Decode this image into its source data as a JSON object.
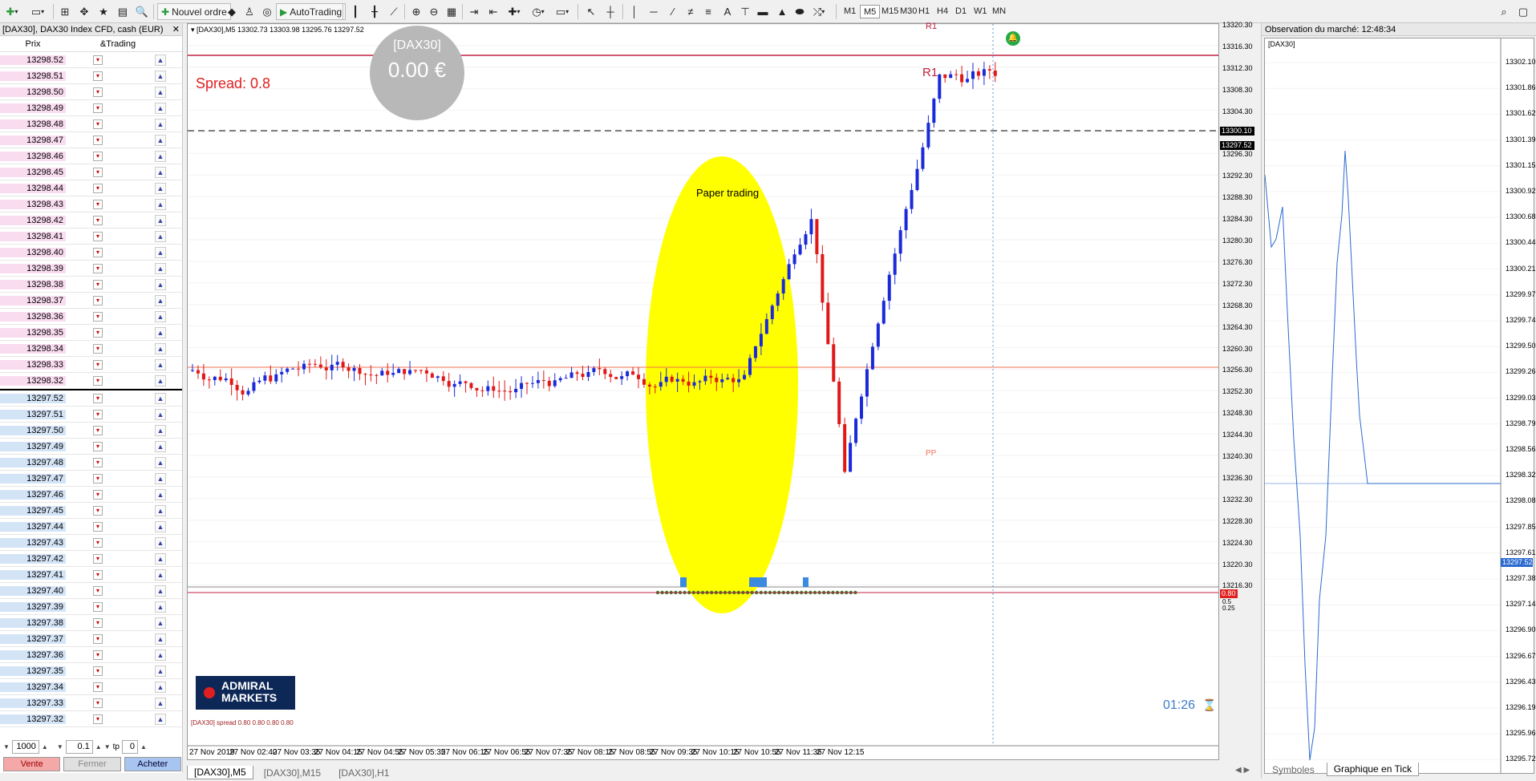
{
  "toolbar": {
    "new_order": "Nouvel ordre",
    "autotrading": "AutoTrading",
    "timeframes": [
      "M1",
      "M5",
      "M15",
      "M30",
      "H1",
      "H4",
      "D1",
      "W1",
      "MN"
    ],
    "active_timeframe": "M5"
  },
  "dom": {
    "title": "[DAX30], DAX30 Index CFD, cash (EUR)",
    "col_price": "Prix",
    "col_trading": "&Trading",
    "asks": [
      "13298.52",
      "13298.51",
      "13298.50",
      "13298.49",
      "13298.48",
      "13298.47",
      "13298.46",
      "13298.45",
      "13298.44",
      "13298.43",
      "13298.42",
      "13298.41",
      "13298.40",
      "13298.39",
      "13298.38",
      "13298.37",
      "13298.36",
      "13298.35",
      "13298.34",
      "13298.33",
      "13298.32"
    ],
    "bids": [
      "13297.52",
      "13297.51",
      "13297.50",
      "13297.49",
      "13297.48",
      "13297.47",
      "13297.46",
      "13297.45",
      "13297.44",
      "13297.43",
      "13297.42",
      "13297.41",
      "13297.40",
      "13297.39",
      "13297.38",
      "13297.37",
      "13297.36",
      "13297.35",
      "13297.34",
      "13297.33",
      "13297.32"
    ],
    "volume": "1000",
    "lot": "0.1",
    "tp_label": "tp",
    "tp_value": "0",
    "sell": "Vente",
    "close": "Fermer",
    "buy": "Acheter"
  },
  "chart": {
    "header": "[DAX30],M5  13302.73 13303.98 13295.76 13297.52",
    "badge_symbol": "[DAX30]",
    "badge_value": "0.00 €",
    "spread": "Spread:  0.8",
    "paper_trading": "Paper trading",
    "r1": "R1",
    "pp": "PP",
    "countdown": "01:26",
    "sub_header": "[DAX30] spread 0.80 0.80 0.80 0.80",
    "brand_line1": "ADMIRAL",
    "brand_line2": "MARKETS",
    "current_price": "13297.52",
    "line_price": "13300.10",
    "spread_value": "0.80",
    "sub_axis": [
      "0.5",
      "0.25"
    ],
    "price_labels": [
      "13320.30",
      "13316.30",
      "13312.30",
      "13308.30",
      "13304.30",
      "13300.30",
      "13296.30",
      "13292.30",
      "13288.30",
      "13284.30",
      "13280.30",
      "13276.30",
      "13272.30",
      "13268.30",
      "13264.30",
      "13260.30",
      "13256.30",
      "13252.30",
      "13248.30",
      "13244.30",
      "13240.30",
      "13236.30",
      "13232.30",
      "13228.30",
      "13224.30",
      "13220.30",
      "13216.30"
    ],
    "date_labels": [
      "27 Nov 2019",
      "27 Nov 02:40",
      "27 Nov 03:35",
      "27 Nov 04:15",
      "27 Nov 04:55",
      "27 Nov 05:35",
      "27 Nov 06:15",
      "27 Nov 06:55",
      "27 Nov 07:35",
      "27 Nov 08:15",
      "27 Nov 08:55",
      "27 Nov 09:35",
      "27 Nov 10:15",
      "27 Nov 10:55",
      "27 Nov 11:35",
      "27 Nov 12:15"
    ]
  },
  "tabs": [
    "[DAX30],M5",
    "[DAX30],M15",
    "[DAX30],H1"
  ],
  "active_tab": 0,
  "market_watch": {
    "title": "Observation du marché: 12:48:34",
    "chart_label": "[DAX30]",
    "price_labels": [
      "13302.10",
      "13301.86",
      "13301.62",
      "13301.39",
      "13301.15",
      "13300.92",
      "13300.68",
      "13300.44",
      "13300.21",
      "13299.97",
      "13299.74",
      "13299.50",
      "13299.26",
      "13299.03",
      "13298.79",
      "13298.56",
      "13298.32",
      "13298.08",
      "13297.85",
      "13297.61",
      "13297.38",
      "13297.14",
      "13296.90",
      "13296.67",
      "13296.43",
      "13296.19",
      "13295.96",
      "13295.72"
    ],
    "current_price": "13297.52",
    "tab_symbols": "Symboles",
    "tab_tick": "Graphique en Tick",
    "active_tab": 1
  }
}
